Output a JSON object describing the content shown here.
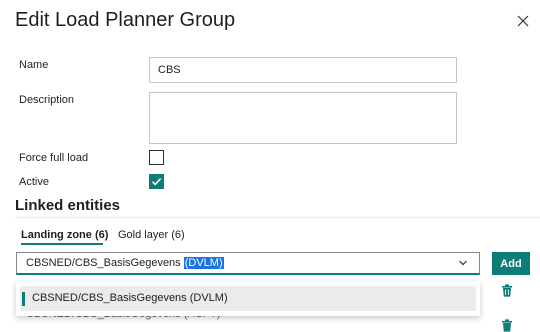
{
  "dialog": {
    "title": "Edit Load Planner Group",
    "close_icon": "close-icon"
  },
  "form": {
    "name_label": "Name",
    "name_value": "CBS",
    "description_label": "Description",
    "description_value": "",
    "force_full_load_label": "Force full load",
    "force_full_load_checked": false,
    "active_label": "Active",
    "active_checked": true
  },
  "linked_entities": {
    "heading": "Linked entities",
    "tabs": [
      {
        "label": "Landing zone (6)",
        "active": true
      },
      {
        "label": "Gold layer (6)",
        "active": false
      }
    ],
    "combo": {
      "value_prefix": "CBSNED/CBS_BasisGegevens ",
      "value_selected": "(DVLM)"
    },
    "add_button": "Add",
    "dropdown_options": [
      "CBSNED/CBS_BasisGegevens (DVLM)"
    ],
    "partially_hidden_row": "CBSNED/CBS_BasisGegevens (ACPT)"
  },
  "colors": {
    "accent": "#0e7c79",
    "selection": "#1a73e8",
    "border": "#c8c6c4"
  }
}
